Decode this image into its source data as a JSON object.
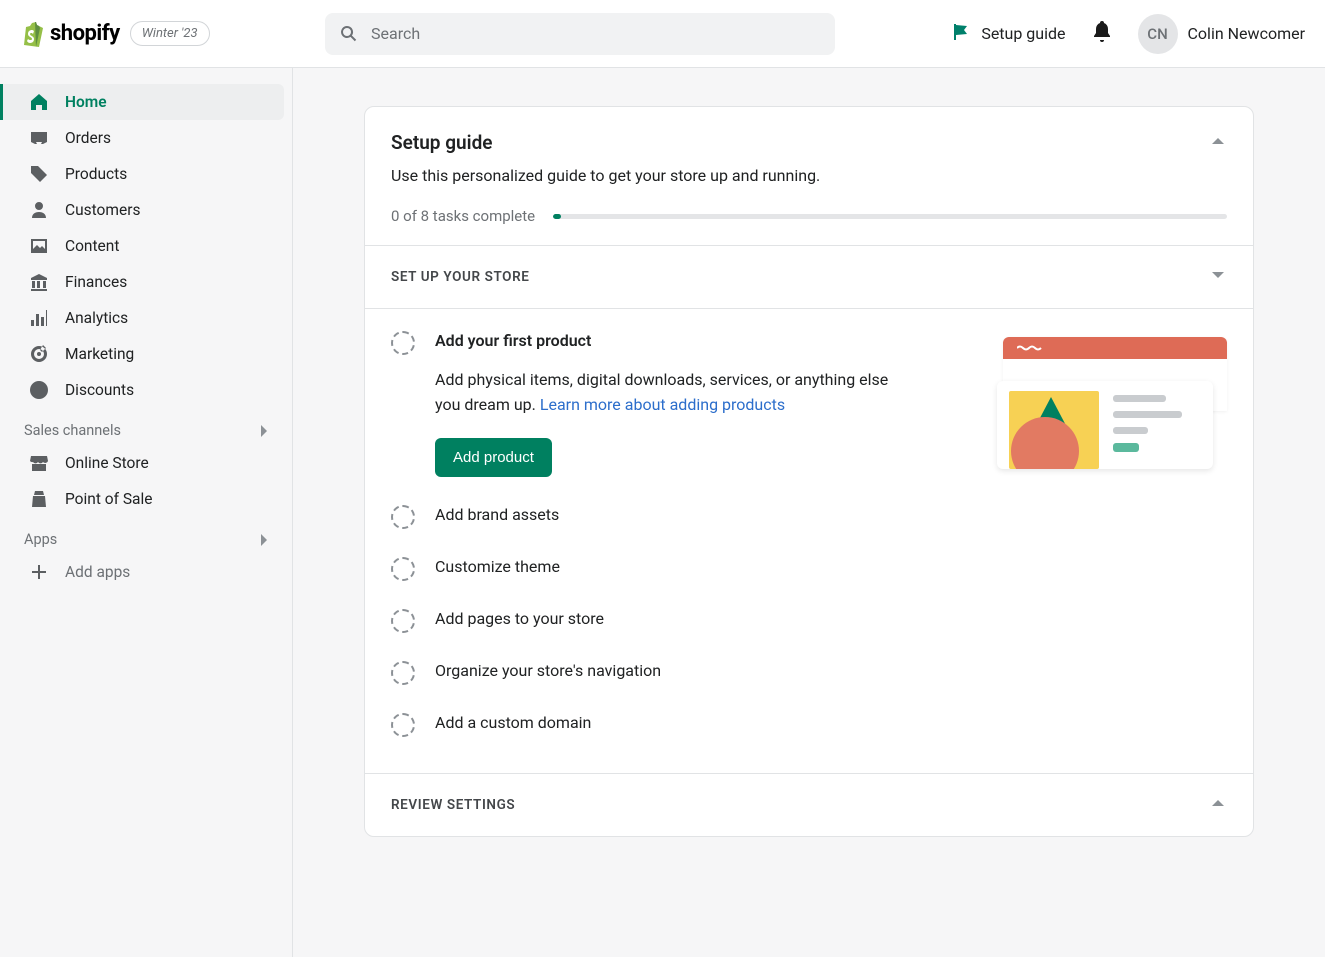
{
  "brand": {
    "name": "shopify",
    "badge": "Winter '23"
  },
  "search": {
    "placeholder": "Search"
  },
  "topbar": {
    "setup_guide_label": "Setup guide",
    "user_initials": "CN",
    "user_name": "Colin Newcomer"
  },
  "sidebar": {
    "nav": [
      {
        "label": "Home"
      },
      {
        "label": "Orders"
      },
      {
        "label": "Products"
      },
      {
        "label": "Customers"
      },
      {
        "label": "Content"
      },
      {
        "label": "Finances"
      },
      {
        "label": "Analytics"
      },
      {
        "label": "Marketing"
      },
      {
        "label": "Discounts"
      }
    ],
    "sales_channels_label": "Sales channels",
    "channels": [
      {
        "label": "Online Store"
      },
      {
        "label": "Point of Sale"
      }
    ],
    "apps_label": "Apps",
    "add_apps_label": "Add apps"
  },
  "guide": {
    "title": "Setup guide",
    "subtitle": "Use this personalized guide to get your store up and running.",
    "progress_text": "0 of 8 tasks complete",
    "section1_label": "SET UP YOUR STORE",
    "section2_label": "REVIEW SETTINGS",
    "expanded_task": {
      "title": "Add your first product",
      "desc_prefix": "Add physical items, digital downloads, services, or anything else you dream up. ",
      "desc_link": "Learn more about adding products",
      "button": "Add product"
    },
    "tasks": [
      {
        "title": "Add brand assets"
      },
      {
        "title": "Customize theme"
      },
      {
        "title": "Add pages to your store"
      },
      {
        "title": "Organize your store's navigation"
      },
      {
        "title": "Add a custom domain"
      }
    ]
  }
}
